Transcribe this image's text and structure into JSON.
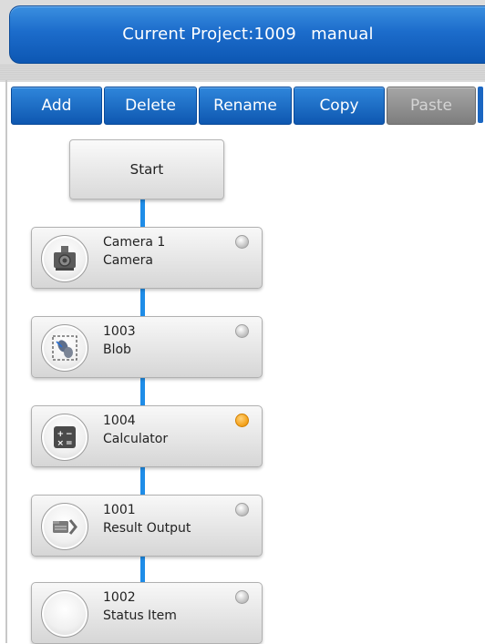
{
  "header": {
    "title_prefix": "Current Project:",
    "project_id": "1009",
    "mode": "manual"
  },
  "toolbar": {
    "add_label": "Add",
    "delete_label": "Delete",
    "rename_label": "Rename",
    "copy_label": "Copy",
    "paste_label": "Paste"
  },
  "flow": {
    "start_label": "Start",
    "nodes": [
      {
        "line1": "Camera 1",
        "line2": "Camera",
        "icon": "camera-icon",
        "status": "idle"
      },
      {
        "line1": "1003",
        "line2": "Blob",
        "icon": "blob-icon",
        "status": "idle"
      },
      {
        "line1": "1004",
        "line2": "Calculator",
        "icon": "calculator-icon",
        "status": "active"
      },
      {
        "line1": "1001",
        "line2": "Result Output",
        "icon": "result-output-icon",
        "status": "idle"
      },
      {
        "line1": "1002",
        "line2": "Status Item",
        "icon": "status-item-icon",
        "status": "idle"
      }
    ]
  },
  "colors": {
    "accent": "#1c6ccb",
    "connector": "#1f8de8",
    "active_status": "#f5a623"
  }
}
